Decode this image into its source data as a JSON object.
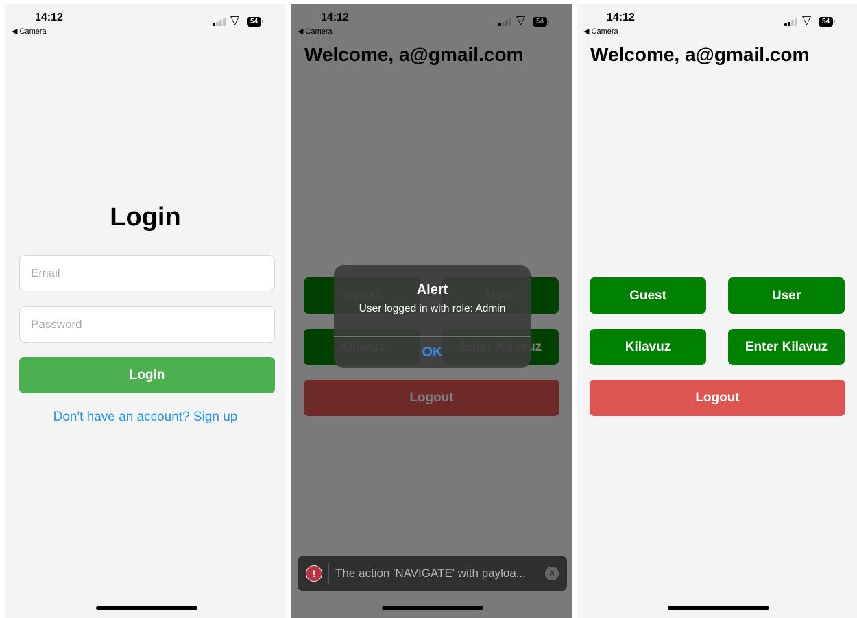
{
  "status_bar": {
    "time": "14:12",
    "back_label": "◀ Camera",
    "battery": "54"
  },
  "login_screen": {
    "title": "Login",
    "email_placeholder": "Email",
    "password_placeholder": "Password",
    "login_button": "Login",
    "signup_link": "Don't have an account? Sign up"
  },
  "home_screen": {
    "welcome": "Welcome, a@gmail.com",
    "buttons": [
      "Guest",
      "User",
      "Kilavuz",
      "Enter Kilavuz"
    ],
    "logout": "Logout"
  },
  "alert": {
    "title": "Alert",
    "message": "User logged in with role: Admin",
    "ok": "OK"
  },
  "toast": {
    "icon": "!",
    "message": "The action 'NAVIGATE' with payloa...",
    "close": "×"
  },
  "colors": {
    "green_button": "#008000",
    "login_button": "#4caf50",
    "logout_button": "#dc5550",
    "link": "#2196f3"
  }
}
